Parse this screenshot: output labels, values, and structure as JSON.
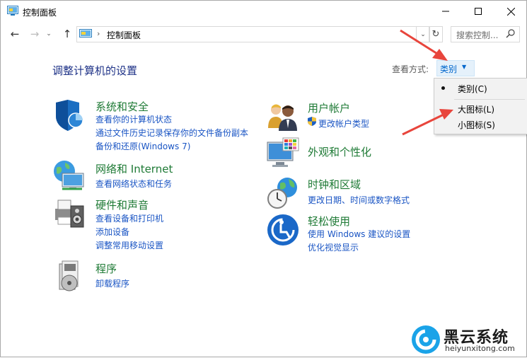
{
  "window": {
    "title": "控制面板",
    "buttons": [
      "minimize",
      "maximize",
      "close"
    ]
  },
  "address": {
    "breadcrumb": "控制面板",
    "search_placeholder": "搜索控制..."
  },
  "content": {
    "heading": "调整计算机的设置",
    "view_label": "查看方式:",
    "view_value": "类别",
    "categories": [
      {
        "title": "系统和安全",
        "icon": "shield-icon",
        "links": [
          "查看你的计算机状态",
          "通过文件历史记录保存你的文件备份副本",
          "备份和还原(Windows 7)"
        ]
      },
      {
        "title": "网络和 Internet",
        "icon": "network-globe-icon",
        "links": [
          "查看网络状态和任务"
        ]
      },
      {
        "title": "硬件和声音",
        "icon": "printer-speaker-icon",
        "links": [
          "查看设备和打印机",
          "添加设备",
          "调整常用移动设置"
        ]
      },
      {
        "title": "程序",
        "icon": "programs-disc-icon",
        "links": [
          "卸载程序"
        ]
      },
      {
        "title": "用户帐户",
        "icon": "users-icon",
        "links": [
          "更改帐户类型"
        ]
      },
      {
        "title": "外观和个性化",
        "icon": "monitor-palette-icon",
        "links": []
      },
      {
        "title": "时钟和区域",
        "icon": "clock-globe-icon",
        "links": [
          "更改日期、时间或数字格式"
        ]
      },
      {
        "title": "轻松使用",
        "icon": "ease-of-access-icon",
        "links": [
          "使用 Windows 建议的设置",
          "优化视觉显示"
        ]
      }
    ]
  },
  "view_menu": {
    "items": [
      {
        "label": "类别(C)",
        "selected": true
      },
      {
        "label": "大图标(L)",
        "selected": false
      },
      {
        "label": "小图标(S)",
        "selected": false
      }
    ]
  },
  "watermark": {
    "title": "黑云系统",
    "url": "heiyunxitong.com"
  },
  "colors": {
    "link": "#1a55c4",
    "category_title": "#1e7a35",
    "heading": "#1e3287",
    "annotation_arrow": "#e8453c",
    "watermark_accent": "#1aa3e8"
  }
}
